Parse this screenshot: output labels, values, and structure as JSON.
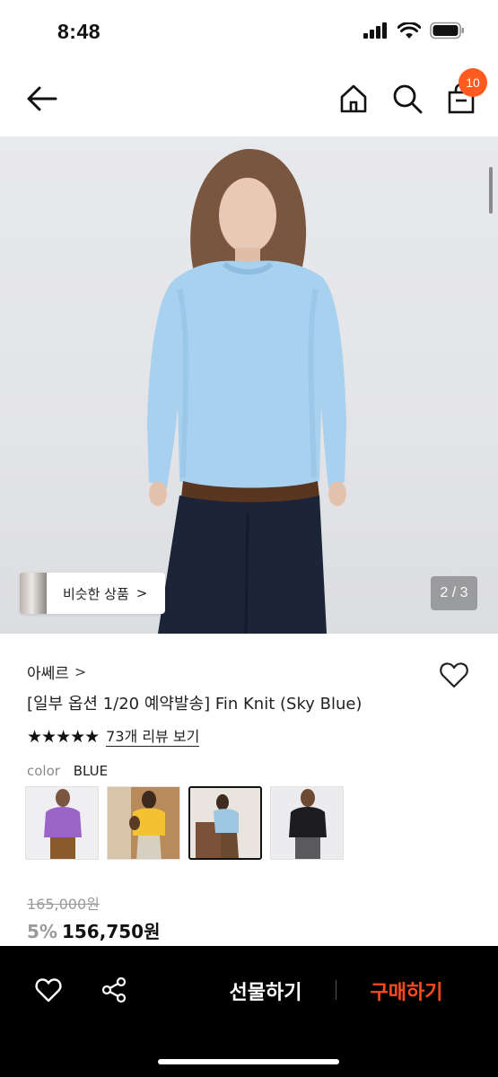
{
  "status_bar": {
    "time": "8:48",
    "icons": [
      "signal-icon",
      "wifi-icon",
      "battery-icon"
    ]
  },
  "nav": {
    "icons": [
      "back-arrow-icon",
      "home-icon",
      "search-icon",
      "shopping-bag-icon"
    ],
    "cart_count": "10",
    "badge_color": "#ff5a1f"
  },
  "gallery": {
    "similar_label": "비슷한 상품",
    "similar_chevron": ">",
    "page_indicator": "2 / 3"
  },
  "product": {
    "brand": "아쎄르",
    "brand_chevron": ">",
    "title": "[일부 옵션 1/20 예약발송] Fin Knit (Sky Blue)",
    "stars": "★★★★★",
    "review_link": "73개 리뷰 보기",
    "color_label": "color",
    "color_value": "BLUE",
    "swatches": [
      "purple",
      "yellow",
      "sky blue",
      "black"
    ],
    "original_price": "165,000원",
    "discount": "5%",
    "price": "156,750원"
  },
  "bottom_bar": {
    "gift_label": "선물하기",
    "buy_label": "구매하기",
    "buy_color": "#ff4a1a",
    "icons": [
      "heart-icon",
      "share-icon"
    ]
  }
}
